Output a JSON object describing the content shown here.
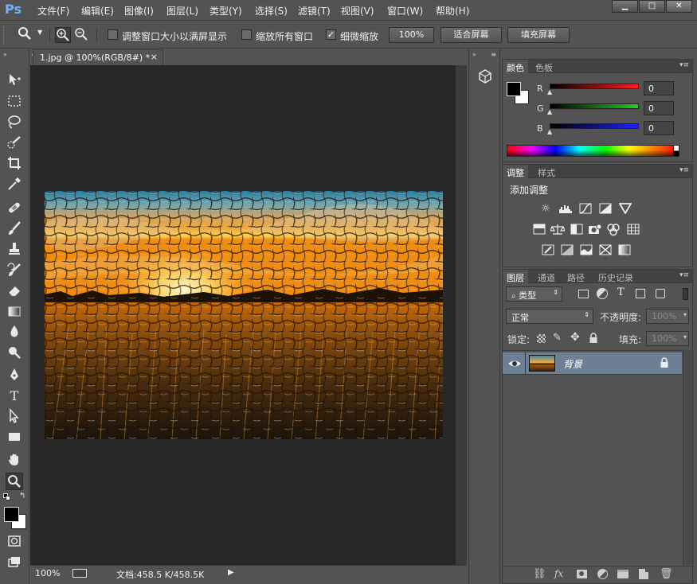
{
  "app": {
    "logo": "Ps"
  },
  "menu": [
    "文件(F)",
    "编辑(E)",
    "图像(I)",
    "图层(L)",
    "类型(Y)",
    "选择(S)",
    "滤镜(T)",
    "视图(V)",
    "窗口(W)",
    "帮助(H)"
  ],
  "window_buttons": {
    "minimize": "▁",
    "maximize": "□",
    "close": "✕"
  },
  "options": {
    "resize_windows_label": "调整窗口大小以满屏显示",
    "resize_windows_checked": false,
    "zoom_all_label": "缩放所有窗口",
    "zoom_all_checked": false,
    "scrubby_label": "细微缩放",
    "scrubby_checked": true,
    "check_mark": "✓",
    "btn_100": "100%",
    "btn_fit": "适合屏幕",
    "btn_fill": "填充屏幕"
  },
  "document": {
    "tab_title": "1.jpg @ 100%(RGB/8#) *",
    "close": "×"
  },
  "status": {
    "zoom": "100%",
    "doc_info": "文档:458.5 K/458.5K",
    "arrow": "▶"
  },
  "color_panel": {
    "tabs": [
      "颜色",
      "色板"
    ],
    "channels": [
      {
        "label": "R",
        "value": "0",
        "color": "#ff2020"
      },
      {
        "label": "G",
        "value": "0",
        "color": "#20c020"
      },
      {
        "label": "B",
        "value": "0",
        "color": "#2020ff"
      }
    ],
    "foreground": "#000000",
    "background": "#ffffff"
  },
  "adjust_panel": {
    "tabs": [
      "调整",
      "样式"
    ],
    "title": "添加调整"
  },
  "layers_panel": {
    "tabs": [
      "图层",
      "通道",
      "路径",
      "历史记录"
    ],
    "filter_label": "类型",
    "blend_mode": "正常",
    "opacity_label": "不透明度:",
    "opacity_value": "100%",
    "lock_label": "锁定:",
    "fill_label": "填充:",
    "fill_value": "100%",
    "layers": [
      {
        "name": "背景",
        "visible": true,
        "locked": true
      }
    ]
  },
  "icons": {
    "eye": "◉",
    "lock": "🔒"
  }
}
